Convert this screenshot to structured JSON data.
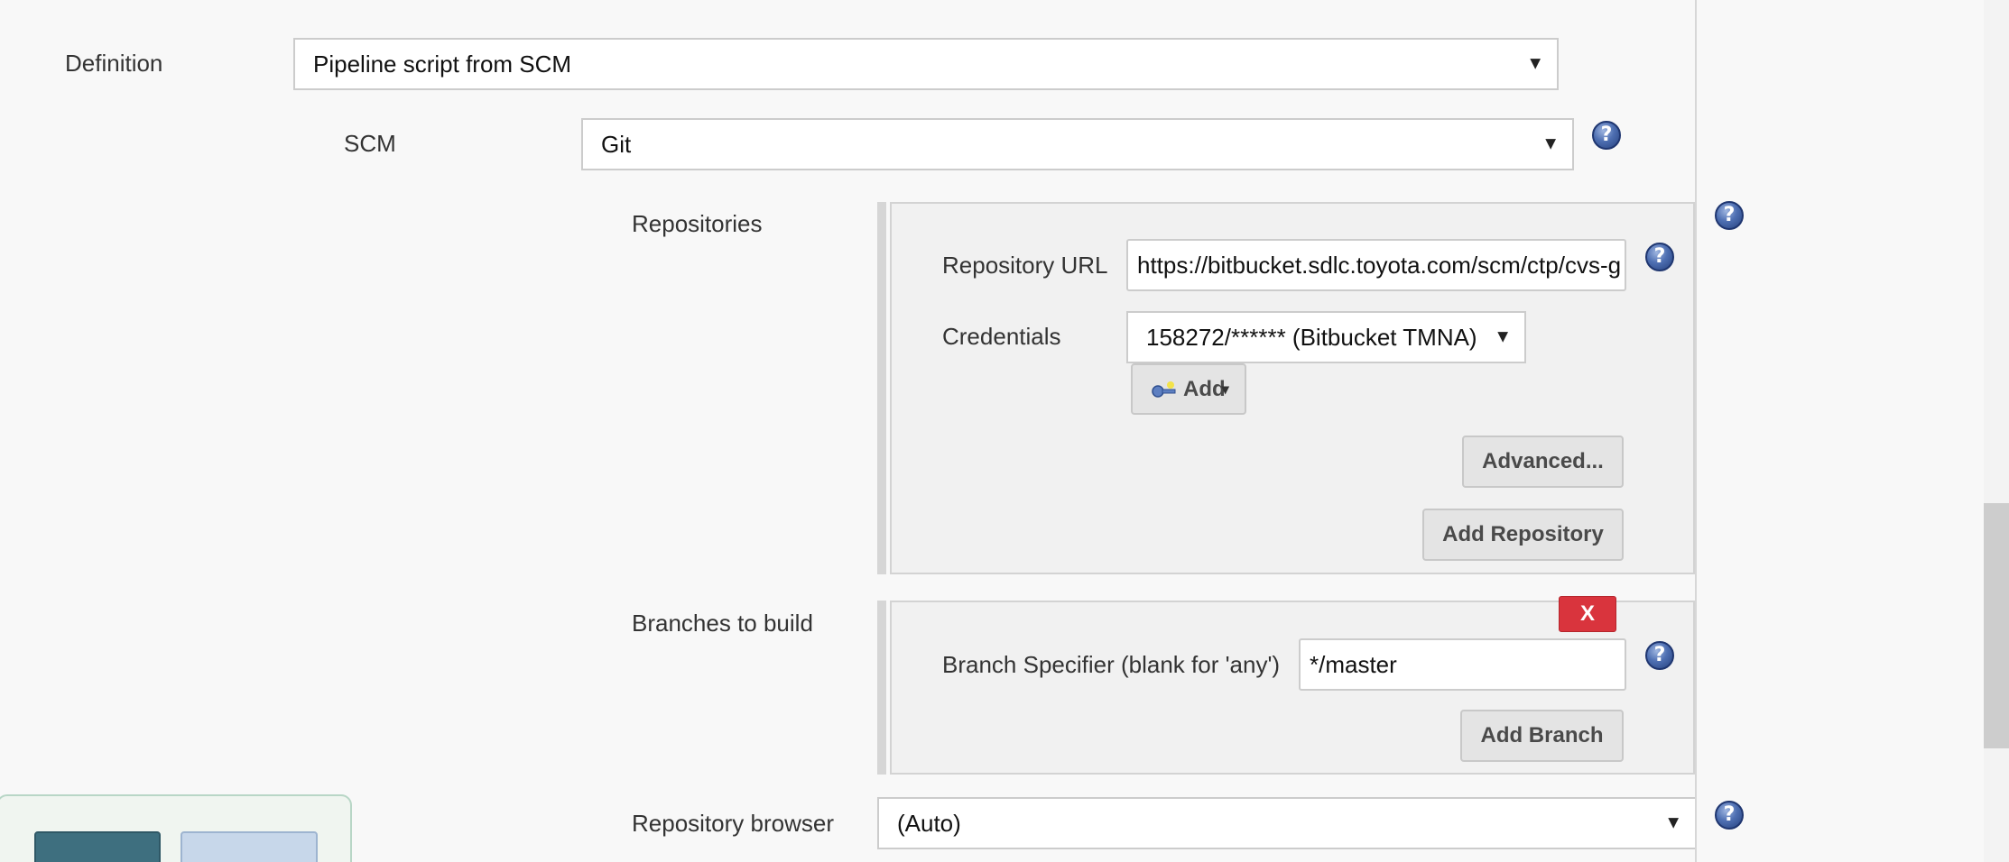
{
  "definition": {
    "label": "Definition",
    "selected": "Pipeline script from SCM"
  },
  "scm": {
    "label": "SCM",
    "selected": "Git"
  },
  "repositories": {
    "label": "Repositories",
    "repository_url": {
      "label": "Repository URL",
      "value": "https://bitbucket.sdlc.toyota.com/scm/ctp/cvs-g"
    },
    "credentials": {
      "label": "Credentials",
      "selected": "158272/****** (Bitbucket TMNA)",
      "add_label": "Add"
    },
    "advanced_label": "Advanced...",
    "add_repository_label": "Add Repository"
  },
  "branches": {
    "label": "Branches to build",
    "delete_label": "X",
    "branch_specifier": {
      "label": "Branch Specifier (blank for 'any')",
      "value": "*/master"
    },
    "add_branch_label": "Add Branch"
  },
  "repository_browser": {
    "label": "Repository browser",
    "selected": "(Auto)"
  },
  "icons": {
    "help": "help-icon",
    "dropdown": "dropdown-caret-icon",
    "credentials_add": "key-icon"
  },
  "colors": {
    "background": "#f8f8f8",
    "delete": "#d9343d",
    "help": "#4e6fb2",
    "save": "#3e6f7f",
    "apply": "#c7d7ea"
  }
}
